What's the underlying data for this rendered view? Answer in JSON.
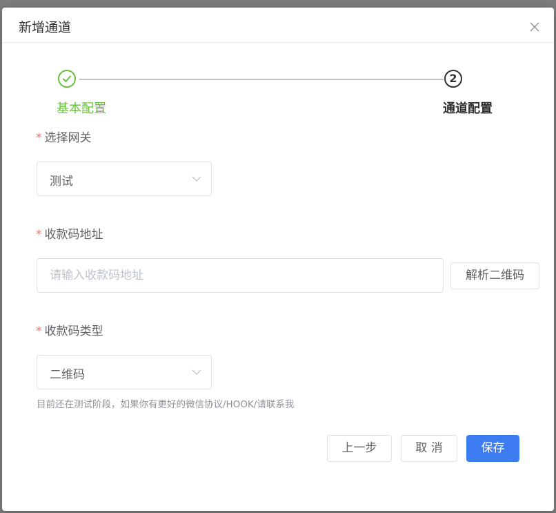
{
  "dialog": {
    "title": "新增通道",
    "close_icon": "close-icon"
  },
  "steps": [
    {
      "index": "1",
      "title": "基本配置",
      "status": "finished",
      "icon": "check-icon"
    },
    {
      "index": "2",
      "title": "通道配置",
      "status": "process"
    }
  ],
  "form": {
    "gateway": {
      "label": "选择网关",
      "required_mark": "*",
      "value": "测试"
    },
    "qr_address": {
      "label": "收款码地址",
      "required_mark": "*",
      "placeholder": "请输入收款码地址",
      "value": "",
      "parse_button": "解析二维码"
    },
    "qr_type": {
      "label": "收款码类型",
      "required_mark": "*",
      "value": "二维码",
      "hint": "目前还在测试阶段，如果你有更好的微信协议/HOOK/请联系我"
    }
  },
  "footer": {
    "prev_label": "上一步",
    "cancel_label": "取 消",
    "save_label": "保存"
  },
  "colors": {
    "success": "#67c23a",
    "primary": "#3d7cf0",
    "required": "#f56c6c",
    "overlay": "#7d7d7d"
  }
}
